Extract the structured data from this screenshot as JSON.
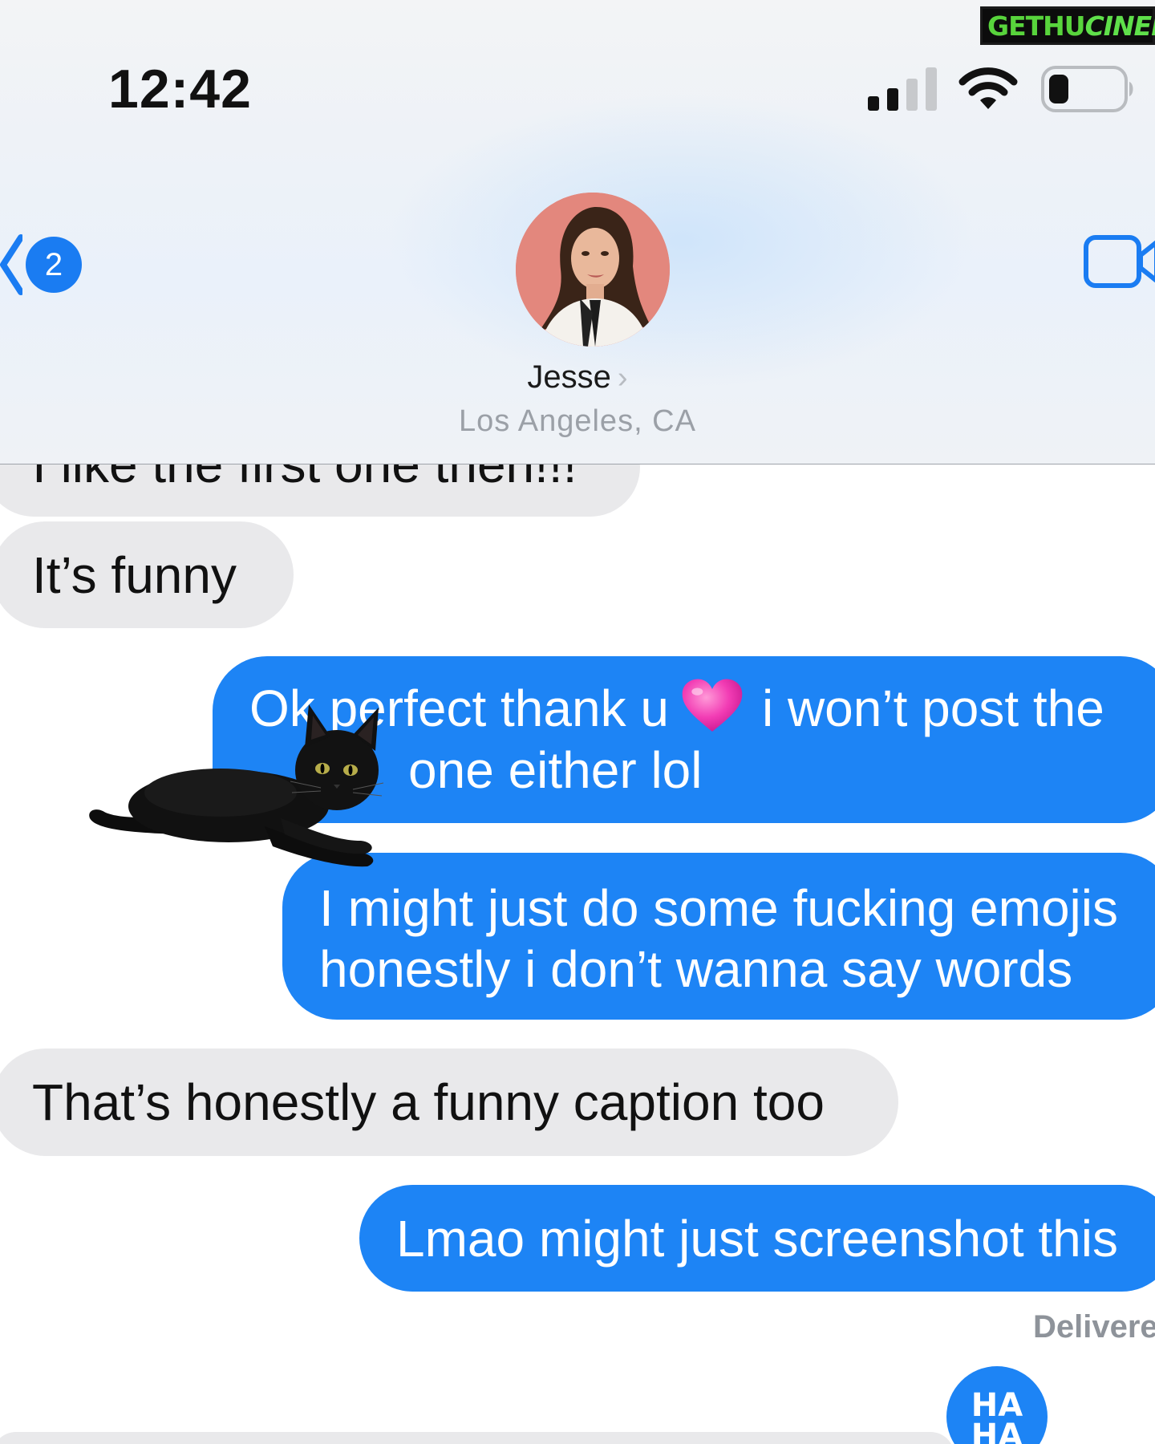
{
  "status_bar": {
    "time": "12:42"
  },
  "watermark": {
    "part1": "GETHU",
    "part2": "CINEMA"
  },
  "nav": {
    "back_badge": "2",
    "contact_name": "Jesse",
    "contact_chevron": "›",
    "contact_location": "Los Angeles, CA"
  },
  "messages": [
    {
      "side": "received",
      "text": "I like the first one then!!!"
    },
    {
      "side": "received",
      "text": "It’s funny"
    },
    {
      "side": "sent",
      "line1_before_emoji": "Ok perfect thank u",
      "emoji": "pink-heart",
      "line1_after_emoji": "i won’t post the",
      "line2": "one either lol"
    },
    {
      "side": "sent",
      "line1": "I might just do some fucking emojis",
      "line2": "honestly i don’t wanna say words"
    },
    {
      "side": "received",
      "text": "That’s honestly a funny caption too"
    },
    {
      "side": "sent",
      "text": "Lmao might just screenshot this"
    }
  ],
  "delivered_label": "Delivered",
  "tapback": {
    "line1": "HA",
    "line2": "HA"
  },
  "colors": {
    "sent_bubble": "#1d84f5",
    "received_bubble": "#e9e9eb",
    "badge": "#1a7cf2"
  }
}
